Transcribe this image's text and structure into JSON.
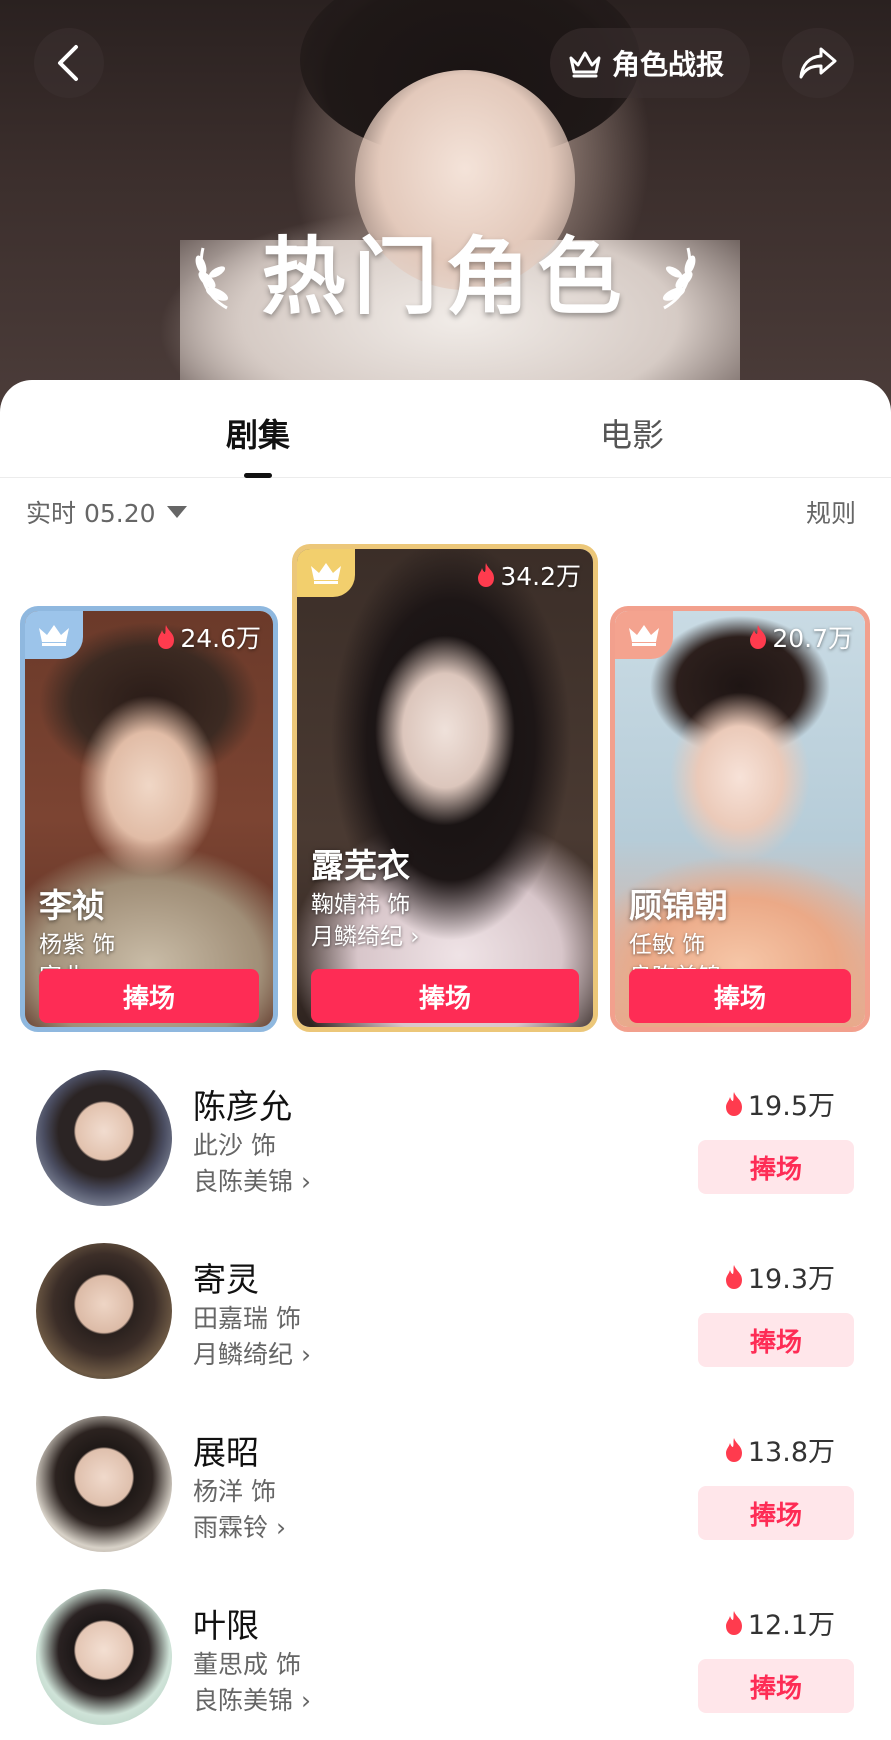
{
  "header": {
    "report_label": "角色战报",
    "title": "热门角色"
  },
  "tabs": [
    {
      "label": "剧集",
      "active": true
    },
    {
      "label": "电影",
      "active": false
    }
  ],
  "filter": {
    "label": "实时 05.20",
    "rules_label": "规则"
  },
  "top_cards": [
    {
      "rank": 2,
      "name": "李祯",
      "actor": "杨紫 饰",
      "show": "家业 ›",
      "heat": "24.6万",
      "cheer_label": "捧场"
    },
    {
      "rank": 1,
      "name": "露芜衣",
      "actor": "鞠婧祎 饰",
      "show": "月鳞绮纪 ›",
      "heat": "34.2万",
      "cheer_label": "捧场"
    },
    {
      "rank": 3,
      "name": "顾锦朝",
      "actor": "任敏 饰",
      "show": "良陈美锦 ›",
      "heat": "20.7万",
      "cheer_label": "捧场"
    }
  ],
  "list": [
    {
      "name": "陈彦允",
      "actor": "此沙 饰",
      "show": "良陈美锦 ›",
      "heat": "19.5万",
      "cheer_label": "捧场"
    },
    {
      "name": "寄灵",
      "actor": "田嘉瑞 饰",
      "show": "月鳞绮纪 ›",
      "heat": "19.3万",
      "cheer_label": "捧场"
    },
    {
      "name": "展昭",
      "actor": "杨洋 饰",
      "show": "雨霖铃 ›",
      "heat": "13.8万",
      "cheer_label": "捧场"
    },
    {
      "name": "叶限",
      "actor": "董思成 饰",
      "show": "良陈美锦 ›",
      "heat": "12.1万",
      "cheer_label": "捧场"
    }
  ],
  "colors": {
    "accent": "#fe2c55",
    "accent_light": "#ffe6ea",
    "rank1_border": "#ecc779",
    "rank2_border": "#8fb8df",
    "rank3_border": "#f2a08d",
    "flame": "#ff3b4e"
  },
  "icons": [
    "back-arrow-icon",
    "crown-icon",
    "share-icon",
    "laurel-icon",
    "caret-down-icon",
    "flame-icon"
  ]
}
